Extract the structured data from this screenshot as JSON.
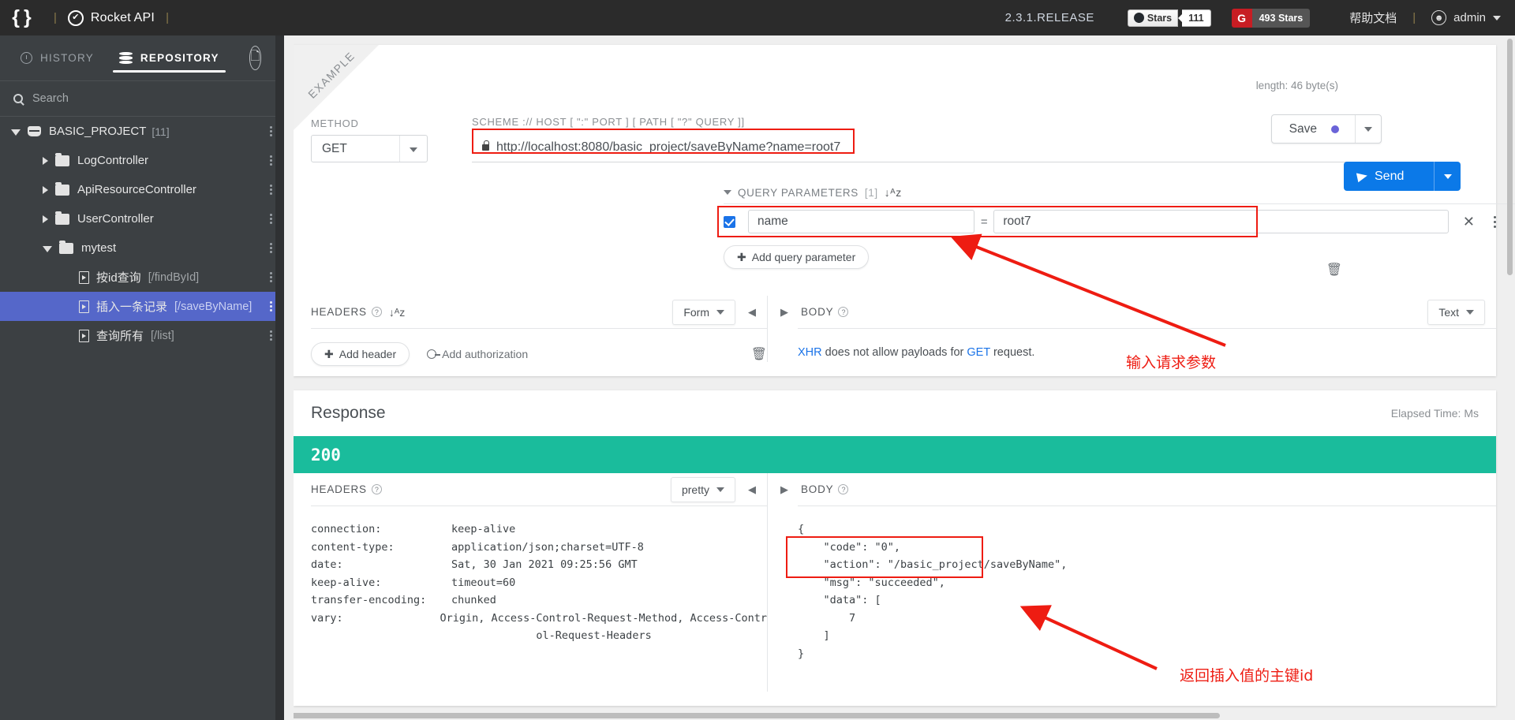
{
  "topbar": {
    "braces_logo": "{ }",
    "rocket_icon": "rocket-check-icon",
    "brand": "Rocket API",
    "release": "2.3.1.RELEASE",
    "github": {
      "label": "Stars",
      "count": "111"
    },
    "gitee": {
      "logo": "G",
      "label": "493 Stars"
    },
    "help_doc": "帮助文档",
    "user": "admin"
  },
  "sidebar": {
    "tabs": [
      {
        "label": "HISTORY",
        "icon": "clock-icon",
        "active": false
      },
      {
        "label": "REPOSITORY",
        "icon": "database-icon",
        "active": true
      }
    ],
    "doc_icon": "document-icon",
    "collapse_icon": "chevron-left-icon",
    "search_placeholder": "Search",
    "tree": [
      {
        "label": "BASIC_PROJECT",
        "count": "[11]",
        "type": "project",
        "depth": 0,
        "open": true
      },
      {
        "label": "LogController",
        "count": "",
        "type": "folder",
        "depth": 1,
        "open": false
      },
      {
        "label": "ApiResourceController",
        "count": "",
        "type": "folder",
        "depth": 1,
        "open": false
      },
      {
        "label": "UserController",
        "count": "",
        "type": "folder",
        "depth": 1,
        "open": false
      },
      {
        "label": "mytest",
        "count": "",
        "type": "folder",
        "depth": 1,
        "open": true
      },
      {
        "label": "按id查询",
        "path": "[/findById]",
        "type": "file",
        "depth": 2,
        "selected": false
      },
      {
        "label": "插入一条记录",
        "path": "[/saveByName]",
        "type": "file",
        "depth": 2,
        "selected": true
      },
      {
        "label": "查询所有",
        "path": "[/list]",
        "type": "file",
        "depth": 2,
        "selected": false
      }
    ]
  },
  "request": {
    "ribbon": "EXAMPLE",
    "method_label": "METHOD",
    "method_value": "GET",
    "url_label": "SCHEME :// HOST [ \":\" PORT ] [ PATH [ \"?\" QUERY ]]",
    "url_value": "http://localhost:8080/basic_project/saveByName?name=root7",
    "length_note": "length: 46 byte(s)",
    "save_label": "Save",
    "send_label": "Send",
    "query_params": {
      "title": "QUERY PARAMETERS",
      "count": "[1]",
      "sort_icon": "sort-alpha-icon",
      "rows": [
        {
          "enabled": true,
          "key": "name",
          "eq": "=",
          "value": "root7"
        }
      ],
      "add_label": "Add query parameter",
      "delete_icon": "trash-icon"
    },
    "headers_section": {
      "title": "HEADERS",
      "mode": "Form",
      "add_header": "Add header",
      "add_authorization": "Add authorization",
      "delete_icon": "trash-icon"
    },
    "body_section": {
      "title": "BODY",
      "mode": "Text",
      "note_prefix": "XHR",
      "note_middle": " does not allow payloads for ",
      "note_method": "GET",
      "note_suffix": " request."
    }
  },
  "response": {
    "title": "Response",
    "elapsed": "Elapsed Time: Ms",
    "status": "200",
    "headers_title": "HEADERS",
    "headers_mode": "pretty",
    "headers": [
      {
        "key": "connection:",
        "value": "keep-alive"
      },
      {
        "key": "content-type:",
        "value": "application/json;charset=UTF-8"
      },
      {
        "key": "date:",
        "value": "Sat, 30 Jan 2021 09:25:56 GMT"
      },
      {
        "key": "keep-alive:",
        "value": "timeout=60"
      },
      {
        "key": "transfer-encoding:",
        "value": "chunked"
      },
      {
        "key": "vary:",
        "value": "Origin, Access-Control-Request-Method, Access-Contr\n               ol-Request-Headers"
      }
    ],
    "body_title": "BODY",
    "body_json": "{\n    \"code\": \"0\",\n    \"action\": \"/basic_project/saveByName\",\n    \"msg\": \"succeeded\",\n    \"data\": [\n        7\n    ]\n}"
  },
  "annotations": {
    "color": "#ee1c12",
    "top_note": "输入请求参数",
    "bottom_note": "返回插入值的主键id"
  }
}
